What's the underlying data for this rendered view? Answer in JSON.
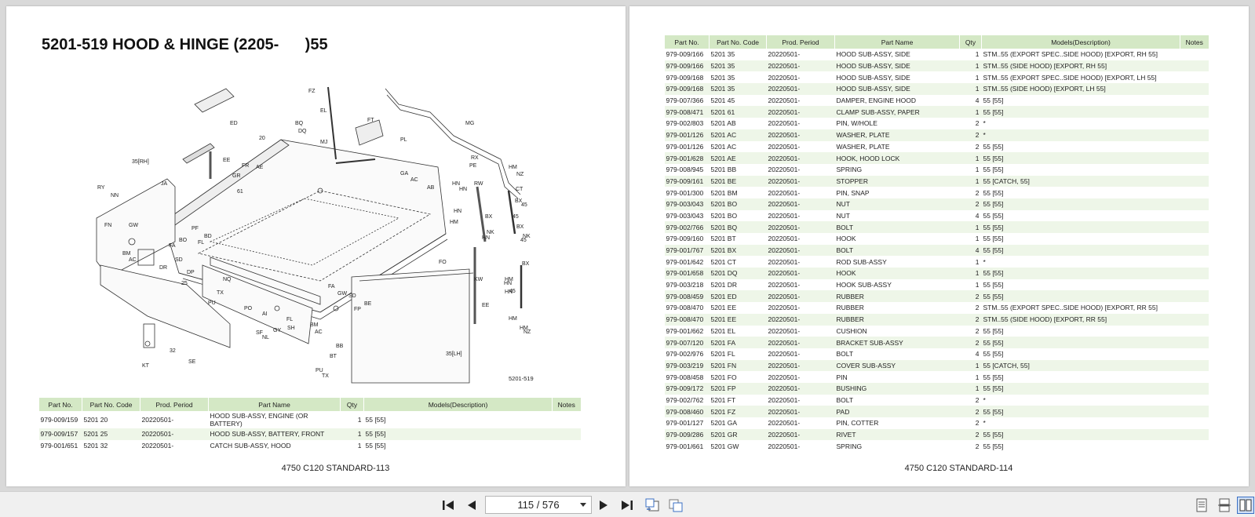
{
  "left_page": {
    "title": "5201-519 HOOD & HINGE (2205-      )55",
    "footer": "4750 C120 STANDARD-113",
    "diagram_code": "5201-519",
    "diagram_labels": [
      "FZ",
      "EL",
      "FT",
      "BQ",
      "DQ",
      "MJ",
      "PL",
      "MG",
      "ED",
      "20",
      "35[RH]",
      "EE",
      "FR",
      "AE",
      "GR",
      "JA",
      "61",
      "RY",
      "NN",
      "GA",
      "AC",
      "AB",
      "HN",
      "HN",
      "RW",
      "RX",
      "PE",
      "HM",
      "NZ",
      "CT",
      "BX",
      "45",
      "45",
      "BX",
      "HM",
      "HN",
      "BX",
      "45",
      "NK",
      "FN",
      "GW",
      "PF",
      "BD",
      "BO",
      "FL",
      "FA",
      "NK",
      "HN",
      "BM",
      "AC",
      "SD",
      "DR",
      "DP",
      "FO",
      "BX",
      "HM",
      "HN",
      "HN",
      "KW",
      "NQ",
      "FA",
      "GW",
      "SD",
      "TX",
      "PU",
      "AI",
      "PO",
      "NL",
      "SF",
      "GY",
      "FL",
      "SH",
      "BM",
      "AC",
      "FP",
      "BE",
      "BB",
      "BT",
      "PU",
      "TX",
      "KT",
      "32",
      "SE",
      "25",
      "35[LH]",
      "EE",
      "HM",
      "HM",
      "NZ",
      "45"
    ],
    "table": {
      "headers": [
        "Part No.",
        "Part No. Code",
        "Prod. Period",
        "Part Name",
        "Qty",
        "Models(Description)",
        "Notes"
      ],
      "rows": [
        [
          "979-009/159",
          "5201 20",
          "20220501-",
          "HOOD SUB-ASSY, ENGINE (OR BATTERY)",
          "1",
          "55 [55]",
          ""
        ],
        [
          "979-009/157",
          "5201 25",
          "20220501-",
          "HOOD SUB-ASSY, BATTERY, FRONT",
          "1",
          "55 [55]",
          ""
        ],
        [
          "979-001/651",
          "5201 32",
          "20220501-",
          "CATCH SUB-ASSY, HOOD",
          "1",
          "55 [55]",
          ""
        ]
      ]
    }
  },
  "right_page": {
    "footer": "4750 C120 STANDARD-114",
    "table": {
      "headers": [
        "Part No.",
        "Part No. Code",
        "Prod. Period",
        "Part Name",
        "Qty",
        "Models(Description)",
        "Notes"
      ],
      "rows": [
        [
          "979-009/166",
          "5201 35",
          "20220501-",
          "HOOD SUB-ASSY, SIDE",
          "1",
          "STM..55 (EXPORT SPEC..SIDE HOOD) [EXPORT, RH 55]",
          ""
        ],
        [
          "979-009/166",
          "5201 35",
          "20220501-",
          "HOOD SUB-ASSY, SIDE",
          "1",
          "STM..55 (SIDE HOOD) [EXPORT, RH 55]",
          ""
        ],
        [
          "979-009/168",
          "5201 35",
          "20220501-",
          "HOOD SUB-ASSY, SIDE",
          "1",
          "STM..55 (EXPORT SPEC..SIDE HOOD) [EXPORT, LH 55]",
          ""
        ],
        [
          "979-009/168",
          "5201 35",
          "20220501-",
          "HOOD SUB-ASSY, SIDE",
          "1",
          "STM..55 (SIDE HOOD) [EXPORT, LH 55]",
          ""
        ],
        [
          "979-007/366",
          "5201 45",
          "20220501-",
          "DAMPER, ENGINE HOOD",
          "4",
          "55 [55]",
          ""
        ],
        [
          "979-008/471",
          "5201 61",
          "20220501-",
          "CLAMP SUB-ASSY, PAPER",
          "1",
          "55 [55]",
          ""
        ],
        [
          "979-002/803",
          "5201 AB",
          "20220501-",
          "PIN, W/HOLE",
          "2",
          "*",
          ""
        ],
        [
          "979-001/126",
          "5201 AC",
          "20220501-",
          "WASHER, PLATE",
          "2",
          "*",
          ""
        ],
        [
          "979-001/126",
          "5201 AC",
          "20220501-",
          "WASHER, PLATE",
          "2",
          "55 [55]",
          ""
        ],
        [
          "979-001/628",
          "5201 AE",
          "20220501-",
          "HOOK, HOOD LOCK",
          "1",
          "55 [55]",
          ""
        ],
        [
          "979-008/945",
          "5201 BB",
          "20220501-",
          "SPRING",
          "1",
          "55 [55]",
          ""
        ],
        [
          "979-009/161",
          "5201 BE",
          "20220501-",
          "STOPPER",
          "1",
          "55 [CATCH, 55]",
          ""
        ],
        [
          "979-001/300",
          "5201 BM",
          "20220501-",
          "PIN, SNAP",
          "2",
          "55 [55]",
          ""
        ],
        [
          "979-003/043",
          "5201 BO",
          "20220501-",
          "NUT",
          "2",
          "55 [55]",
          ""
        ],
        [
          "979-003/043",
          "5201 BO",
          "20220501-",
          "NUT",
          "4",
          "55 [55]",
          ""
        ],
        [
          "979-002/766",
          "5201 BQ",
          "20220501-",
          "BOLT",
          "1",
          "55 [55]",
          ""
        ],
        [
          "979-009/160",
          "5201 BT",
          "20220501-",
          "HOOK",
          "1",
          "55 [55]",
          ""
        ],
        [
          "979-001/767",
          "5201 BX",
          "20220501-",
          "BOLT",
          "4",
          "55 [55]",
          ""
        ],
        [
          "979-001/642",
          "5201 CT",
          "20220501-",
          "ROD SUB-ASSY",
          "1",
          "*",
          ""
        ],
        [
          "979-001/658",
          "5201 DQ",
          "20220501-",
          "HOOK",
          "1",
          "55 [55]",
          ""
        ],
        [
          "979-003/218",
          "5201 DR",
          "20220501-",
          "HOOK SUB-ASSY",
          "1",
          "55 [55]",
          ""
        ],
        [
          "979-008/459",
          "5201 ED",
          "20220501-",
          "RUBBER",
          "2",
          "55 [55]",
          ""
        ],
        [
          "979-008/470",
          "5201 EE",
          "20220501-",
          "RUBBER",
          "2",
          "STM..55 (EXPORT SPEC..SIDE HOOD) [EXPORT, RR 55]",
          ""
        ],
        [
          "979-008/470",
          "5201 EE",
          "20220501-",
          "RUBBER",
          "2",
          "STM..55 (SIDE HOOD) [EXPORT, RR 55]",
          ""
        ],
        [
          "979-001/662",
          "5201 EL",
          "20220501-",
          "CUSHION",
          "2",
          "55 [55]",
          ""
        ],
        [
          "979-007/120",
          "5201 FA",
          "20220501-",
          "BRACKET SUB-ASSY",
          "2",
          "55 [55]",
          ""
        ],
        [
          "979-002/976",
          "5201 FL",
          "20220501-",
          "BOLT",
          "4",
          "55 [55]",
          ""
        ],
        [
          "979-003/219",
          "5201 FN",
          "20220501-",
          "COVER SUB-ASSY",
          "1",
          "55 [CATCH, 55]",
          ""
        ],
        [
          "979-008/458",
          "5201 FO",
          "20220501-",
          "PIN",
          "1",
          "55 [55]",
          ""
        ],
        [
          "979-009/172",
          "5201 FP",
          "20220501-",
          "BUSHING",
          "1",
          "55 [55]",
          ""
        ],
        [
          "979-002/762",
          "5201 FT",
          "20220501-",
          "BOLT",
          "2",
          "*",
          ""
        ],
        [
          "979-008/460",
          "5201 FZ",
          "20220501-",
          "PAD",
          "2",
          "55 [55]",
          ""
        ],
        [
          "979-001/127",
          "5201 GA",
          "20220501-",
          "PIN, COTTER",
          "2",
          "*",
          ""
        ],
        [
          "979-009/286",
          "5201 GR",
          "20220501-",
          "RIVET",
          "2",
          "55 [55]",
          ""
        ],
        [
          "979-001/661",
          "5201 GW",
          "20220501-",
          "SPRING",
          "2",
          "55 [55]",
          ""
        ]
      ]
    }
  },
  "toolbar": {
    "page_indicator": "115 / 576",
    "icons": [
      "first-page-icon",
      "previous-page-icon",
      "next-page-icon",
      "last-page-icon",
      "rotate-icon",
      "fit-page-icon",
      "single-page-icon",
      "continuous-page-icon",
      "two-page-icon"
    ],
    "active_color": "#3a6fc4"
  }
}
